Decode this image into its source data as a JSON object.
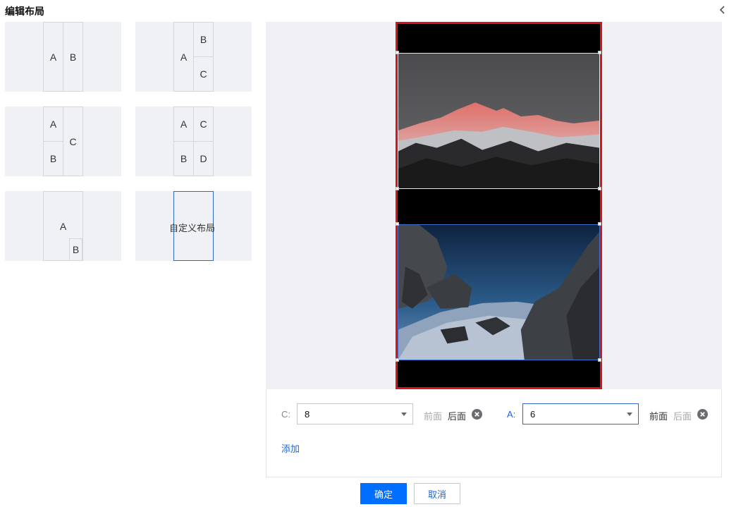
{
  "header": {
    "title": "编辑布局",
    "collapse_icon": "chevron-left-icon"
  },
  "layouts": {
    "card1": {
      "a": "A",
      "b": "B"
    },
    "card2": {
      "a": "A",
      "b": "B",
      "c": "C"
    },
    "card3": {
      "a": "A",
      "b": "B",
      "c": "C"
    },
    "card4": {
      "a": "A",
      "b": "B",
      "c": "C",
      "d": "D"
    },
    "card5": {
      "a": "A",
      "b": "B"
    },
    "card6": {
      "label": "自定义布局"
    }
  },
  "controls": {
    "row1": {
      "label": "C:",
      "value": "8",
      "front": "前面",
      "back": "后面",
      "remove_icon": "close-circle-icon"
    },
    "row2": {
      "label": "A:",
      "value": "6",
      "front": "前面",
      "back": "后面",
      "remove_icon": "close-circle-icon"
    },
    "add_label": "添加"
  },
  "footer": {
    "confirm_label": "确定",
    "cancel_label": "取消"
  },
  "colors": {
    "primary": "#006eff",
    "selected_frame": "#d2161e",
    "link": "#1f66d2"
  }
}
